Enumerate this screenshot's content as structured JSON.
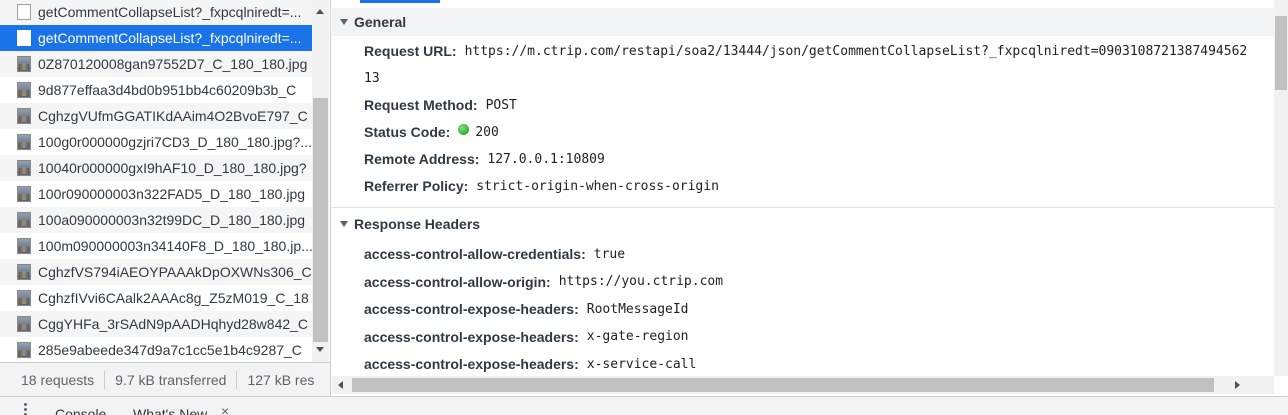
{
  "requests": [
    {
      "name": "getCommentCollapseList?_fxpcqlniredt=...",
      "type": "doc"
    },
    {
      "name": "getCommentCollapseList?_fxpcqlniredt=...",
      "type": "doc"
    },
    {
      "name": "0Z870120008gan97552D7_C_180_180.jpg",
      "type": "img"
    },
    {
      "name": "9d877effaa3d4bd0b951bb4c60209b3b_C",
      "type": "img"
    },
    {
      "name": "CghzgVUfmGGATIKdAAim4O2BvoE797_C",
      "type": "img"
    },
    {
      "name": "100g0r000000gzjri7CD3_D_180_180.jpg?...",
      "type": "img"
    },
    {
      "name": "10040r000000gxI9hAF10_D_180_180.jpg?",
      "type": "img"
    },
    {
      "name": "100r090000003n322FAD5_D_180_180.jpg",
      "type": "img"
    },
    {
      "name": "100a090000003n32t99DC_D_180_180.jpg",
      "type": "img"
    },
    {
      "name": "100m090000003n34140F8_D_180_180.jp...",
      "type": "img"
    },
    {
      "name": "CghzfVS794iAEOYPAAAkDpOXWNs306_C",
      "type": "img"
    },
    {
      "name": "CghzfIVvi6CAalk2AAAc8g_Z5zM019_C_18",
      "type": "img"
    },
    {
      "name": "CggYHFa_3rSAdN9pAADHqhyd28w842_C",
      "type": "img"
    },
    {
      "name": "285e9abeede347d9a7c1cc5e1b4c9287_C",
      "type": "img"
    }
  ],
  "selected_index": 1,
  "status_bar": {
    "requests": "18 requests",
    "transferred": "9.7 kB transferred",
    "resources": "127 kB res"
  },
  "general": {
    "title": "General",
    "request_url_key": "Request URL:",
    "request_url_val": "https://m.ctrip.com/restapi/soa2/13444/json/getCommentCollapseList?_fxpcqlniredt=0903108721387494562",
    "request_url_cont": "13",
    "method_key": "Request Method:",
    "method_val": "POST",
    "status_key": "Status Code:",
    "status_val": "200",
    "remote_key": "Remote Address:",
    "remote_val": "127.0.0.1:10809",
    "referrer_key": "Referrer Policy:",
    "referrer_val": "strict-origin-when-cross-origin"
  },
  "response_headers": {
    "title": "Response Headers",
    "items": [
      {
        "key": "access-control-allow-credentials:",
        "val": "true"
      },
      {
        "key": "access-control-allow-origin:",
        "val": "https://you.ctrip.com"
      },
      {
        "key": "access-control-expose-headers:",
        "val": "RootMessageId"
      },
      {
        "key": "access-control-expose-headers:",
        "val": "x-gate-region"
      },
      {
        "key": "access-control-expose-headers:",
        "val": "x-service-call"
      }
    ]
  },
  "drawer": {
    "console_tab": "Console",
    "whats_new_tab": "What's New",
    "close_symbol": "×"
  },
  "colors": {
    "selected_row": "#1a73e8",
    "status_ok": "#0a9d0a"
  }
}
